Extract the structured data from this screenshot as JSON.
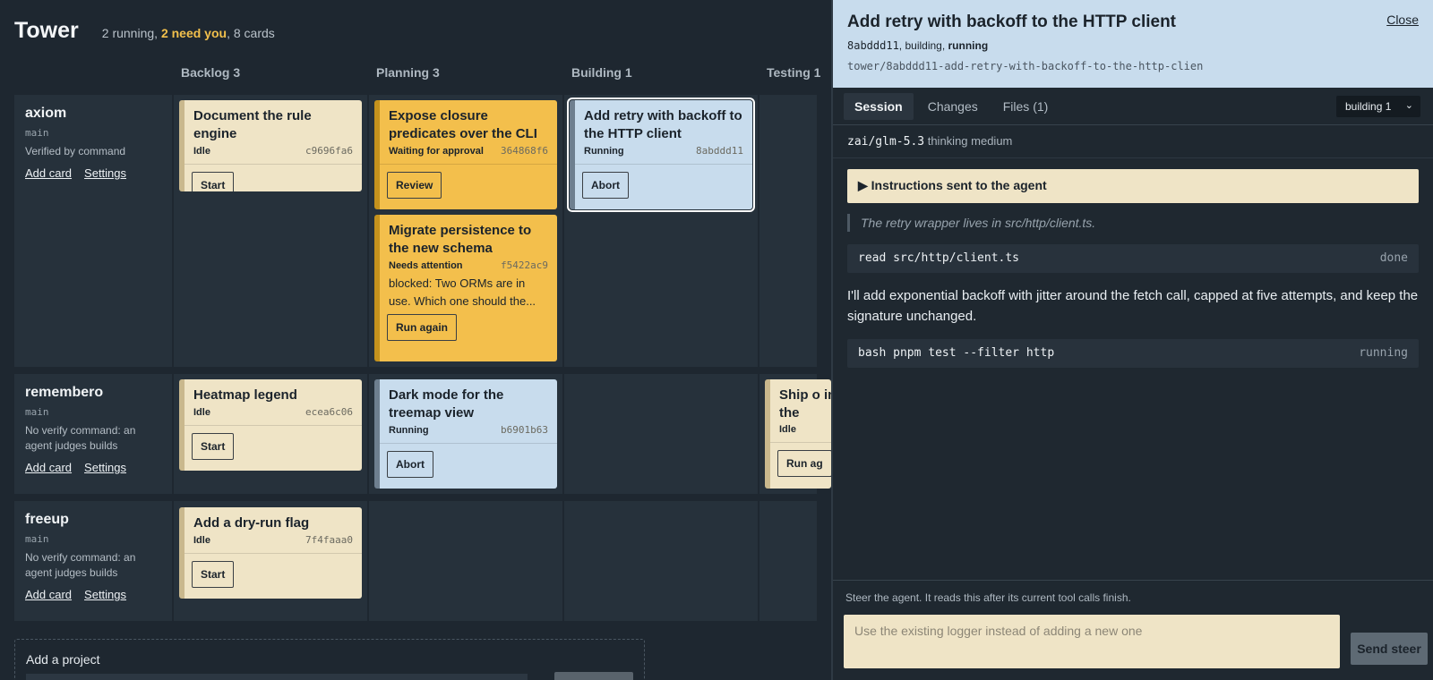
{
  "app": {
    "title": "Tower",
    "summary_running": "2 running, ",
    "summary_need": "2 need you",
    "summary_cards": ", 8 cards"
  },
  "columns": [
    "Backlog 3",
    "Planning 3",
    "Building 1",
    "Testing 1"
  ],
  "projects": [
    {
      "name": "axiom",
      "branch": "main",
      "verify": "Verified by command",
      "add_card": "Add card",
      "settings": "Settings"
    },
    {
      "name": "remembero",
      "branch": "main",
      "verify": "No verify command: an agent judges builds",
      "add_card": "Add card",
      "settings": "Settings"
    },
    {
      "name": "freeup",
      "branch": "main",
      "verify": "No verify command: an agent judges builds",
      "add_card": "Add card",
      "settings": "Settings"
    }
  ],
  "cards": {
    "doc_rule": {
      "title": "Document the rule engine",
      "status": "Idle",
      "hash": "c9696fa6",
      "action": "Start"
    },
    "closure": {
      "title": "Expose closure predicates over the CLI",
      "status": "Waiting for approval",
      "hash": "364868f6",
      "action": "Review"
    },
    "migrate": {
      "title": "Migrate persistence to the new schema",
      "status": "Needs attention",
      "hash": "f5422ac9",
      "note": "blocked: Two ORMs are in use. Which one should the...",
      "action": "Run again"
    },
    "retry": {
      "title": "Add retry with backoff to the HTTP client",
      "status": "Running",
      "hash": "8abddd11",
      "action": "Abort"
    },
    "heatmap": {
      "title": "Heatmap legend",
      "status": "Idle",
      "hash": "ecea6c06",
      "action": "Start"
    },
    "darkmode": {
      "title": "Dark mode for the treemap view",
      "status": "Running",
      "hash": "b6901b63",
      "action": "Abort"
    },
    "ship": {
      "title": "Ship o in the",
      "status": "Idle",
      "action": "Run ag"
    },
    "dryrun": {
      "title": "Add a dry-run flag",
      "status": "Idle",
      "hash": "7f4faaa0",
      "action": "Start"
    }
  },
  "add_project": {
    "label": "Add a project"
  },
  "detail": {
    "title": "Add retry with backoff to the HTTP client",
    "close": "Close",
    "hash": "8abddd11",
    "phase": ", building, ",
    "state": "running",
    "branch": "tower/8abddd11-add-retry-with-backoff-to-the-http-clien",
    "tabs": [
      "Session",
      "Changes",
      "Files (1)"
    ],
    "phase_select": "building 1",
    "model": "zai/glm-5.3",
    "thinking": "thinking medium",
    "instructions": "▶ Instructions sent to the agent",
    "quote": "The retry wrapper lives in src/http/client.ts.",
    "tool1_cmd": "read src/http/client.ts",
    "tool1_status": "done",
    "message": "I'll add exponential backoff with jitter around the fetch call, capped at five attempts, and keep the signature unchanged.",
    "tool2_cmd": "bash pnpm test --filter http",
    "tool2_status": "running",
    "steer_label": "Steer the agent. It reads this after its current tool calls finish.",
    "steer_placeholder": "Use the existing logger instead of adding a new one",
    "steer_button": "Send steer"
  }
}
